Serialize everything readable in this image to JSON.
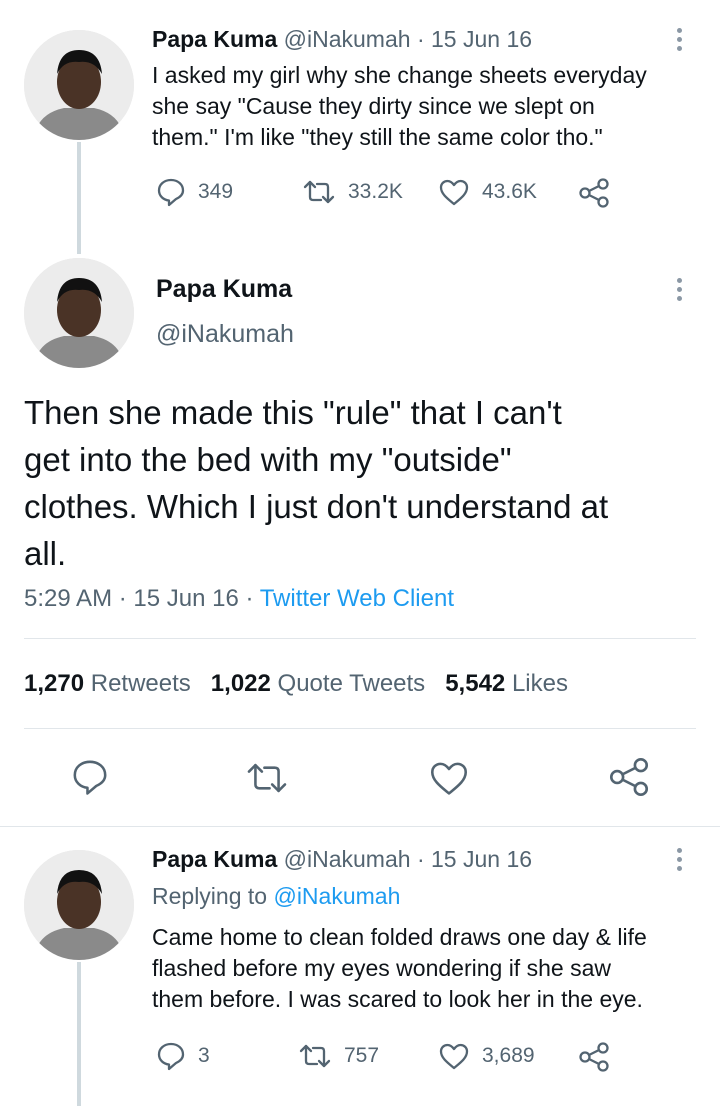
{
  "tweet1": {
    "name": "Papa Kuma",
    "handle": "@iNakumah",
    "date": "· 15 Jun 16",
    "text_lines": [
      "I asked my girl why she change sheets everyday",
      "she say \"Cause they dirty since we slept on",
      "them.\" I'm like \"they still the same color tho.\""
    ],
    "replies": "349",
    "retweets": "33.2K",
    "likes": "43.6K"
  },
  "main_tweet": {
    "name": "Papa Kuma",
    "handle": "@iNakumah",
    "text_lines": [
      "Then she made this \"rule\" that I can't",
      "get into the bed with my \"outside\"",
      "clothes. Which I just don't understand at",
      "all."
    ],
    "time": "5:29 AM · 15 Jun 16 · ",
    "client": "Twitter Web Client",
    "retweets_count": "1,270",
    "retweets_label": "Retweets",
    "quotes_count": "1,022",
    "quotes_label": "Quote Tweets",
    "likes_count": "5,542",
    "likes_label": "Likes"
  },
  "tweet3": {
    "name": "Papa Kuma",
    "handle": "@iNakumah",
    "date": "· 15 Jun 16",
    "replying_prefix": "Replying to",
    "replying_handle": "@iNakumah",
    "text_lines": [
      "Came home to clean folded draws one day & life",
      "flashed before my eyes wondering if she saw",
      "them before. I was scared to look her in the eye."
    ],
    "replies": "3",
    "retweets": "757",
    "likes": "3,689"
  },
  "icons": [
    "reply-icon",
    "retweet-icon",
    "like-icon",
    "share-icon",
    "more-icon"
  ],
  "colors": {
    "link": "#1d9bf0",
    "muted": "#536471",
    "text": "#0f1419",
    "thread_line": "#cfd9de"
  }
}
